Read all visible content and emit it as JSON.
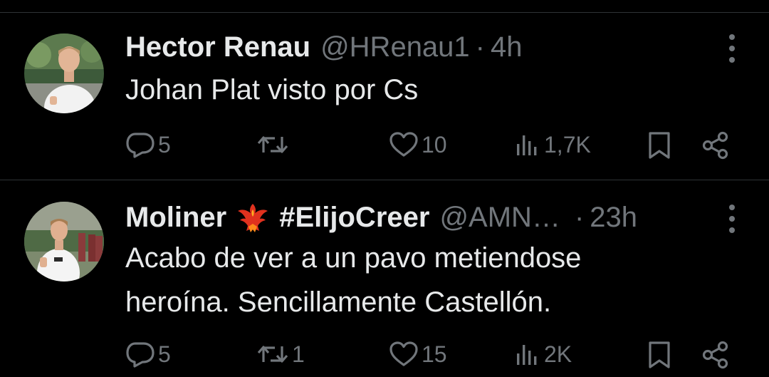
{
  "tweets": [
    {
      "author_name": "Hector Renau",
      "handle": "@HRenau1",
      "separator": "·",
      "time": "4h",
      "text": "Johan Plat visto por Cs",
      "replies": "5",
      "retweets": "",
      "likes": "10",
      "views": "1,7K",
      "avatar_icon": "profile-photo-man-white-shirt"
    },
    {
      "author_name": "Moliner",
      "emoji_icon": "phoenix-emoji",
      "hashtag": "#ElijoCreer",
      "handle": "@AMN…",
      "separator": "·",
      "time": "23h",
      "text_line1": "Acabo de ver a un pavo metiendose",
      "text_line2": "heroína. Sencillamente Castellón.",
      "replies": "5",
      "retweets": "1",
      "likes": "15",
      "views": "2K",
      "avatar_icon": "profile-photo-football-player"
    }
  ],
  "colors": {
    "background": "#000000",
    "text": "#e7e9ea",
    "secondary": "#71767b",
    "divider": "#2f3336"
  }
}
